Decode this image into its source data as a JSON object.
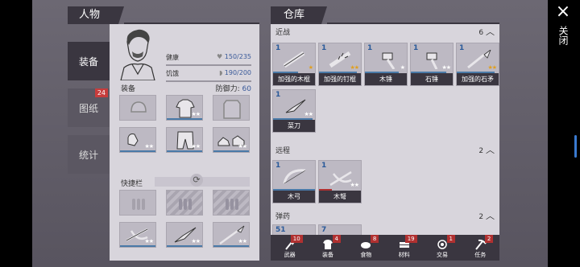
{
  "character": {
    "title": "人物",
    "tabs": [
      {
        "label": "装备",
        "active": true
      },
      {
        "label": "图纸",
        "badge": "24"
      },
      {
        "label": "统计"
      }
    ],
    "stats": {
      "health_label": "健康",
      "health_value": "150/235",
      "hunger_label": "饥饿",
      "hunger_value": "190/200"
    },
    "equip_label": "装备",
    "defense_label": "防御力:",
    "defense_value": "60",
    "quickbar_label": "快捷栏"
  },
  "storage": {
    "title": "仓库",
    "sections": [
      {
        "name": "近战",
        "count": "6",
        "items": [
          {
            "count": "1",
            "name": "加强的木棍",
            "stars": "★",
            "gold": true
          },
          {
            "count": "1",
            "name": "加强的钉棍",
            "stars": "★★",
            "gold": true
          },
          {
            "count": "1",
            "name": "木锤",
            "stars": "★"
          },
          {
            "count": "1",
            "name": "石锤",
            "stars": "★★"
          },
          {
            "count": "1",
            "name": "加强的石矛",
            "stars": "★★",
            "gold": true
          },
          {
            "count": "1",
            "name": "菜刀",
            "stars": "★★"
          }
        ]
      },
      {
        "name": "远程",
        "count": "2",
        "items": [
          {
            "count": "1",
            "name": "木弓"
          },
          {
            "count": "1",
            "name": "木弩",
            "stars": "★★"
          }
        ]
      },
      {
        "name": "弹药",
        "count": "2",
        "items": [
          {
            "count": "51"
          },
          {
            "count": "7"
          }
        ]
      }
    ],
    "categories": [
      {
        "label": "武器",
        "badge": "10"
      },
      {
        "label": "装备",
        "badge": "4"
      },
      {
        "label": "食物",
        "badge": "8"
      },
      {
        "label": "材料",
        "badge": "19"
      },
      {
        "label": "交易",
        "badge": "1"
      },
      {
        "label": "任务",
        "badge": "2"
      }
    ]
  },
  "close": {
    "icon": "×",
    "label": "关闭"
  },
  "colors": {
    "accent": "#3a5a9a",
    "dark": "#3a3640",
    "badge": "#b03030"
  }
}
